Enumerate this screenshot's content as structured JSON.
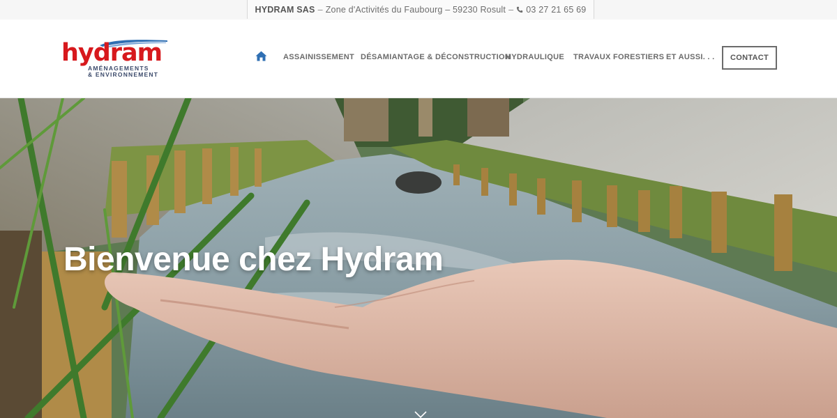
{
  "topbar": {
    "company": "HYDRAM SAS",
    "address": "Zone d'Activités du Faubourg – 59230 Rosult",
    "separator_1": "–",
    "separator_2": "–",
    "phone_icon": "phone-icon",
    "phone": "03 27 21 65 69"
  },
  "logo": {
    "word": "hydram",
    "line1": "AMÉNAGEMENTS",
    "line2": "& ENVIRONNEMENT",
    "brand_red": "#d7191d",
    "brand_blue": "#2f6fb3"
  },
  "nav": {
    "home_icon": "home-icon",
    "home_color": "#2f6fb3",
    "items": [
      {
        "label": "ASSAINISSEMENT"
      },
      {
        "label": "DÉSAMIANTAGE & DÉCONSTRUCTION"
      },
      {
        "label": "HYDRAULIQUE"
      },
      {
        "label": "TRAVAUX FORESTIERS"
      },
      {
        "label": "ET AUSSI. . ."
      }
    ],
    "contact": "CONTACT"
  },
  "hero": {
    "title": "Bienvenue chez Hydram",
    "scroll_icon": "chevron-down-icon"
  }
}
